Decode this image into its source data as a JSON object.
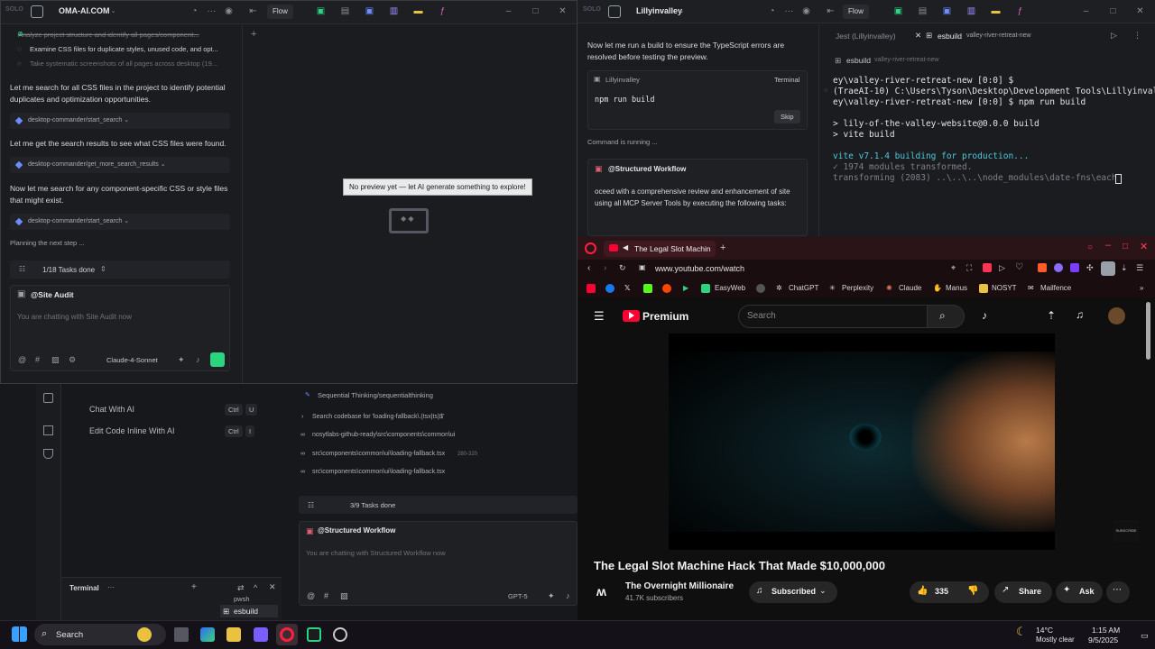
{
  "left_window": {
    "brand": "SOLO",
    "title": "OMA-AI.COM",
    "flow_label": "Flow",
    "tasks_top": [
      "Analyze project structure and identify all pages/component...",
      "Examine CSS files for duplicate styles, unused code, and opt...",
      "Take systematic screenshots of all pages across desktop (19..."
    ],
    "messages": [
      {
        "text": "Let me search for all CSS files in the project to identify potential duplicates and optimization opportunities.",
        "tool": "desktop-commander/start_search"
      },
      {
        "text": "Let me get the search results to see what CSS files were found.",
        "tool": "desktop-commander/get_more_search_results"
      },
      {
        "text": "Now let me search for any component-specific CSS or style files that might exist.",
        "tool": "desktop-commander/start_search"
      }
    ],
    "status": "Planning the next step ...",
    "tasks_done": "1/18 Tasks done",
    "agent": "@Site Audit",
    "placeholder": "You are chatting with Site Audit now",
    "model": "Claude-4-Sonnet",
    "preview_message": "No preview yet — let AI generate something to explore!"
  },
  "background_app": {
    "commands": [
      {
        "label": "Chat With AI",
        "k1": "Ctrl",
        "k2": "U"
      },
      {
        "label": "Edit Code Inline With AI",
        "k1": "Ctrl",
        "k2": "I"
      }
    ],
    "tool_header": "Sequential Thinking/sequentialthinking",
    "search_line": "Search codebase for 'loading-fallback\\.(tsx|ts)$'",
    "results": [
      {
        "path": "nosytlabs-github-ready\\src\\components\\common\\ui",
        "extra": ""
      },
      {
        "path": "src\\components\\common\\ui\\loading-fallback.tsx",
        "extra": "280-320"
      },
      {
        "path": "src\\components\\common\\ui\\loading-fallback.tsx",
        "extra": ""
      }
    ],
    "tasks_done": "3/9 Tasks done",
    "agent": "@Structured Workflow",
    "placeholder": "You are chatting with Structured Workflow now",
    "model": "GPT-5",
    "terminal_label": "Terminal",
    "term_items": [
      "pwsh",
      "esbuild"
    ]
  },
  "right_window": {
    "brand": "SOLO",
    "title": "Lillyinvalley",
    "flow_label": "Flow",
    "message": "Now let me run a build to ensure the TypeScript errors are resolved before testing the preview.",
    "cmd_card_title": "Lillyinvalley",
    "cmd_card_tag": "Terminal",
    "cmd": "npm run build",
    "skip": "Skip",
    "running": "Command is running ...",
    "agent": "@Structured Workflow",
    "agent_text": "oceed with a comprehensive review and enhancement of site using all MCP Server Tools by executing the following tasks:",
    "tabs": [
      {
        "label": "Jest (Lillyinvalley)",
        "sub": ""
      },
      {
        "label": "esbuild",
        "sub": "valley-river-retreat-new"
      }
    ],
    "panel_label": "esbuild",
    "panel_sub": "valley-river-retreat-new",
    "terminal_lines": [
      "ey\\valley-river-retreat-new [0:0] $",
      "(TraeAI-10) C:\\Users\\Tyson\\Desktop\\Development Tools\\Lillyinvall",
      "ey\\valley-river-retreat-new [0:0] $ npm run build",
      "",
      "> lily-of-the-valley-website@0.0.0 build",
      "> vite build",
      "",
      "vite v7.1.4 building for production...",
      "✓ 1974 modules transformed.",
      "transforming (2083) ..\\..\\..\\node_modules\\date-fns\\each"
    ]
  },
  "browser": {
    "tab_title": "The Legal Slot Machin",
    "url": "www.youtube.com/watch",
    "bookmarks": [
      "EasyWeb",
      "ChatGPT",
      "Perplexity",
      "Claude",
      "Manus",
      "NOSYT",
      "Mailfence"
    ],
    "yt_brand": "Premium",
    "search_placeholder": "Search",
    "video_title": "The Legal Slot Machine Hack That Made $10,000,000",
    "channel": "The Overnight Millionaire",
    "subscribers": "41.7K subscribers",
    "subscribed": "Subscribed",
    "likes": "335",
    "share": "Share",
    "ask": "Ask",
    "watermark": "SUBSCRIBE"
  },
  "taskbar": {
    "search": "Search",
    "weather_temp": "14°C",
    "weather_desc": "Mostly clear",
    "time": "1:15 AM",
    "date": "9/5/2025"
  },
  "colors": {
    "accent_green": "#2bd47f",
    "yt_red": "#ff0033",
    "browser_frame": "#2a1418"
  }
}
